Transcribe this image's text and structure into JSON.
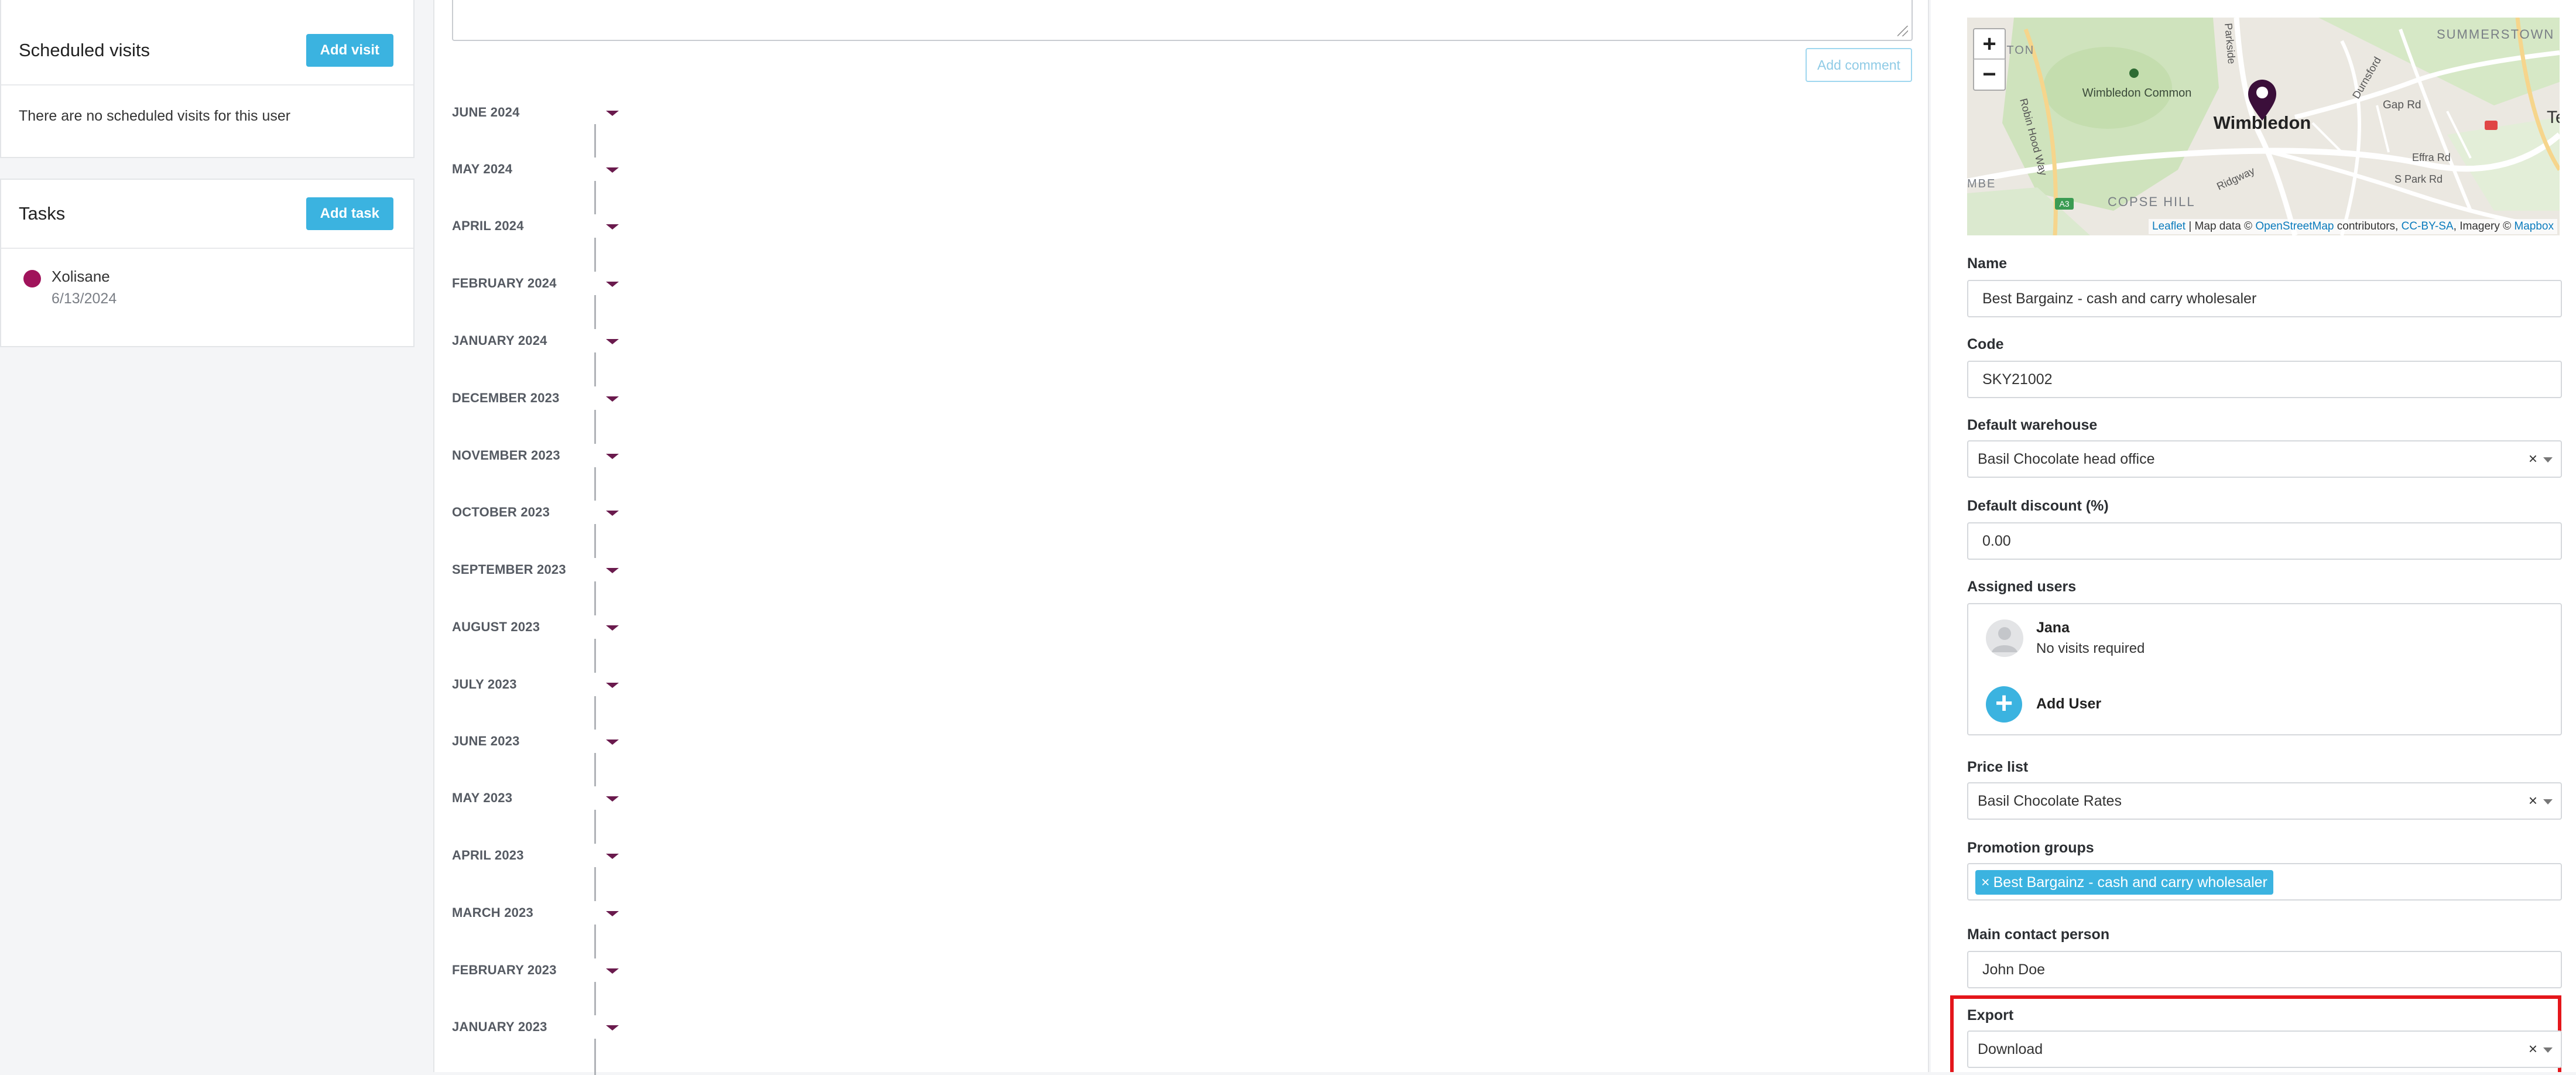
{
  "scheduled_visits": {
    "title": "Scheduled visits",
    "add_button": "Add visit",
    "empty_message": "There are no scheduled visits for this user"
  },
  "tasks": {
    "title": "Tasks",
    "add_button": "Add task",
    "items": [
      {
        "name": "Xolisane",
        "date": "6/13/2024"
      }
    ]
  },
  "activity": {
    "add_comment_label": "Add comment",
    "months": [
      "JUNE 2024",
      "MAY 2024",
      "APRIL 2024",
      "FEBRUARY 2024",
      "JANUARY 2024",
      "DECEMBER 2023",
      "NOVEMBER 2023",
      "OCTOBER 2023",
      "SEPTEMBER 2023",
      "AUGUST 2023",
      "JULY 2023",
      "JUNE 2023",
      "MAY 2023",
      "APRIL 2023",
      "MARCH 2023",
      "FEBRUARY 2023",
      "JANUARY 2023"
    ]
  },
  "map": {
    "zoom_in": "+",
    "zoom_out": "−",
    "labels": {
      "wimbledon": "Wimbledon",
      "common": "Wimbledon Common",
      "summerstown": "SUMMERSTOWN",
      "copse_hill": "COPSE HILL",
      "gap_rd": "Gap Rd",
      "effra_rd": "Effra Rd",
      "s_park_rd": "S Park Rd",
      "ridgway": "Ridgway",
      "robin_hood_way": "Robin Hood Way",
      "parkside": "Parkside",
      "durnsford": "Durnsford",
      "a3": "A3",
      "ston": "STON",
      "mbe": "MBE",
      "te": "Te"
    },
    "attribution": {
      "leaflet": "Leaflet",
      "map_data": " | Map data © ",
      "osm": "OpenStreetMap",
      "contributors": " contributors, ",
      "license": "CC-BY-SA",
      "imagery": ", Imagery © ",
      "mapbox": "Mapbox"
    }
  },
  "form": {
    "name": {
      "label": "Name",
      "value": "Best Bargainz - cash and carry wholesaler"
    },
    "code": {
      "label": "Code",
      "value": "SKY21002"
    },
    "default_warehouse": {
      "label": "Default warehouse",
      "value": "Basil Chocolate head office"
    },
    "default_discount": {
      "label": "Default discount (%)",
      "value": "0.00"
    },
    "assigned_users": {
      "label": "Assigned users",
      "users": [
        {
          "name": "Jana",
          "note": "No visits required"
        }
      ],
      "add_label": "Add User"
    },
    "price_list": {
      "label": "Price list",
      "value": "Basil Chocolate Rates"
    },
    "promotion_groups": {
      "label": "Promotion groups",
      "tags": [
        "Best Bargainz - cash and carry wholesaler"
      ]
    },
    "main_contact": {
      "label": "Main contact person",
      "value": "John Doe"
    },
    "export": {
      "label": "Export",
      "value": "Download"
    },
    "clear_symbol": "×"
  },
  "colors": {
    "accent": "#3bb3e0",
    "task_dot": "#a0135b",
    "highlight": "#e4161b"
  }
}
